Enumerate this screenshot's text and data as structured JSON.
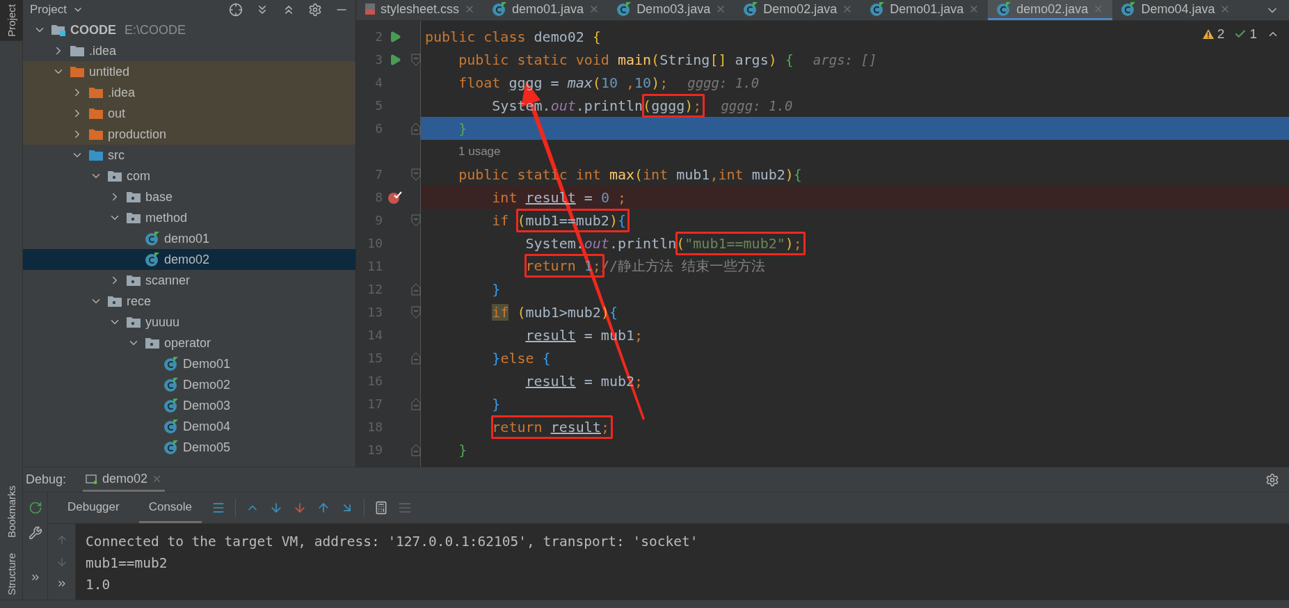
{
  "left_stripe": {
    "top": [
      {
        "label": "Project",
        "selected": true
      }
    ],
    "bottom": [
      {
        "label": "Bookmarks",
        "selected": false
      },
      {
        "label": "Structure",
        "selected": false
      }
    ]
  },
  "project_panel": {
    "title": "Project",
    "tree": [
      {
        "name": "COODE",
        "path": "E:\\COODE",
        "kind": "module",
        "expanded": true,
        "selected": false,
        "highlighted": false,
        "children": [
          {
            "name": ".idea",
            "kind": "folder",
            "expanded": false,
            "selected": false,
            "highlighted": false
          },
          {
            "name": "untitled",
            "kind": "excluded",
            "expanded": true,
            "selected": false,
            "highlighted": true,
            "children": [
              {
                "name": ".idea",
                "kind": "excluded",
                "expanded": false,
                "selected": false,
                "highlighted": true
              },
              {
                "name": "out",
                "kind": "excluded",
                "expanded": false,
                "selected": false,
                "highlighted": true
              },
              {
                "name": "production",
                "kind": "excluded",
                "expanded": false,
                "selected": false,
                "highlighted": true
              },
              {
                "name": "src",
                "kind": "source",
                "expanded": true,
                "selected": false,
                "highlighted": false,
                "children": [
                  {
                    "name": "com",
                    "kind": "package",
                    "expanded": true,
                    "selected": false,
                    "highlighted": false,
                    "children": [
                      {
                        "name": "base",
                        "kind": "package",
                        "expanded": false,
                        "selected": false,
                        "highlighted": false
                      },
                      {
                        "name": "method",
                        "kind": "package",
                        "expanded": true,
                        "selected": false,
                        "highlighted": false,
                        "children": [
                          {
                            "name": "demo01",
                            "kind": "class",
                            "selected": false,
                            "highlighted": false
                          },
                          {
                            "name": "demo02",
                            "kind": "class",
                            "selected": true,
                            "highlighted": false
                          }
                        ]
                      },
                      {
                        "name": "scanner",
                        "kind": "package",
                        "expanded": false,
                        "selected": false,
                        "highlighted": false
                      }
                    ]
                  },
                  {
                    "name": "rece",
                    "kind": "package",
                    "expanded": true,
                    "selected": false,
                    "highlighted": false,
                    "children": [
                      {
                        "name": "yuuuu",
                        "kind": "package",
                        "expanded": true,
                        "selected": false,
                        "highlighted": false,
                        "children": [
                          {
                            "name": "operator",
                            "kind": "package",
                            "expanded": true,
                            "selected": false,
                            "highlighted": false,
                            "children": [
                              {
                                "name": "Demo01",
                                "kind": "class",
                                "selected": false,
                                "highlighted": false
                              },
                              {
                                "name": "Demo02",
                                "kind": "class",
                                "selected": false,
                                "highlighted": false
                              },
                              {
                                "name": "Demo03",
                                "kind": "class",
                                "selected": false,
                                "highlighted": false
                              },
                              {
                                "name": "Demo04",
                                "kind": "class",
                                "selected": false,
                                "highlighted": false
                              },
                              {
                                "name": "Demo05",
                                "kind": "class",
                                "selected": false,
                                "highlighted": false
                              }
                            ]
                          }
                        ]
                      }
                    ]
                  }
                ]
              }
            ]
          }
        ]
      }
    ]
  },
  "editor": {
    "tabs": [
      {
        "label": "stylesheet.css",
        "kind": "css",
        "selected": false
      },
      {
        "label": "demo01.java",
        "kind": "java",
        "selected": false
      },
      {
        "label": "Demo03.java",
        "kind": "java",
        "selected": false
      },
      {
        "label": "Demo02.java",
        "kind": "java",
        "selected": false
      },
      {
        "label": "Demo01.java",
        "kind": "java",
        "selected": false
      },
      {
        "label": "demo02.java",
        "kind": "java",
        "selected": true
      },
      {
        "label": "Demo04.java",
        "kind": "java",
        "selected": false
      }
    ],
    "inspections": {
      "warnings": "2",
      "weak_warnings": "1"
    },
    "lines": [
      {
        "kind": "code",
        "number": "2",
        "run": true,
        "breakpoint": false,
        "current": false,
        "fold_start": false,
        "fold_end": false,
        "tokens": [
          {
            "kind": "keyword",
            "text": "public class "
          },
          {
            "kind": "plain",
            "text": "demo02 "
          },
          {
            "kind": "yellow",
            "text": "{"
          }
        ],
        "children": [
          {
            "kind": "code",
            "number": "3",
            "run": true,
            "breakpoint": false,
            "current": false,
            "fold_start": true,
            "fold_end": false,
            "hint": "args: []",
            "tokens": [
              {
                "kind": "keyword",
                "text": "public static void "
              },
              {
                "kind": "decl",
                "text": "main"
              },
              {
                "kind": "yellow",
                "text": "("
              },
              {
                "kind": "plain",
                "text": "String"
              },
              {
                "kind": "yellow",
                "text": "[]"
              },
              {
                "kind": "plain",
                "text": " args"
              },
              {
                "kind": "yellow",
                "text": ")"
              },
              {
                "kind": "green",
                "text": " {"
              }
            ]
          },
          {
            "kind": "code",
            "number": "4",
            "run": false,
            "breakpoint": false,
            "current": false,
            "fold_start": false,
            "fold_end": false,
            "hint": "gggg: 1.0",
            "tokens": [
              {
                "kind": "keyword",
                "text": "float "
              },
              {
                "kind": "warned",
                "text": "gggg"
              },
              {
                "kind": "plain",
                "text": " = "
              },
              {
                "kind": "call",
                "text": "max"
              },
              {
                "kind": "yellow",
                "text": "("
              },
              {
                "kind": "number",
                "text": "10 "
              },
              {
                "kind": "keyword",
                "text": ","
              },
              {
                "kind": "number",
                "text": "10"
              },
              {
                "kind": "yellow",
                "text": ")"
              },
              {
                "kind": "keyword",
                "text": ";"
              }
            ],
            "children": [
              {
                "kind": "code",
                "number": "5",
                "run": false,
                "breakpoint": false,
                "current": false,
                "fold_start": false,
                "fold_end": false,
                "hint": "gggg: 1.0",
                "tokens": [
                  {
                    "kind": "plain",
                    "text": "System."
                  },
                  {
                    "kind": "field",
                    "text": "out"
                  },
                  {
                    "kind": "plain",
                    "text": ".println"
                  },
                  {
                    "kind": "box",
                    "tokens": [
                      {
                        "kind": "yellow",
                        "text": "("
                      },
                      {
                        "kind": "plain",
                        "text": "gggg"
                      },
                      {
                        "kind": "yellow",
                        "text": ")"
                      },
                      {
                        "kind": "keyword",
                        "text": ";"
                      }
                    ]
                  }
                ]
              }
            ]
          },
          {
            "kind": "code",
            "number": "6",
            "run": false,
            "breakpoint": false,
            "current": true,
            "fold_start": false,
            "fold_end": true,
            "tokens": [
              {
                "kind": "green",
                "text": "}"
              }
            ]
          },
          {
            "kind": "usage",
            "text": "1 usage"
          },
          {
            "kind": "code",
            "number": "7",
            "run": false,
            "breakpoint": false,
            "current": false,
            "fold_start": true,
            "fold_end": false,
            "tokens": [
              {
                "kind": "keyword",
                "text": "public static int "
              },
              {
                "kind": "decl",
                "text": "max"
              },
              {
                "kind": "yellow",
                "text": "("
              },
              {
                "kind": "keyword",
                "text": "int "
              },
              {
                "kind": "plain",
                "text": "mub1"
              },
              {
                "kind": "keyword",
                "text": ",int "
              },
              {
                "kind": "plain",
                "text": "mub2"
              },
              {
                "kind": "yellow",
                "text": ")"
              },
              {
                "kind": "green",
                "text": "{"
              }
            ],
            "children": [
              {
                "kind": "code",
                "number": "8",
                "run": false,
                "breakpoint": true,
                "current": false,
                "fold_start": false,
                "fold_end": false,
                "tokens": [
                  {
                    "kind": "keyword",
                    "text": "int "
                  },
                  {
                    "kind": "reassigned",
                    "text": "result"
                  },
                  {
                    "kind": "plain",
                    "text": " = "
                  },
                  {
                    "kind": "number",
                    "text": "0"
                  },
                  {
                    "kind": "keyword",
                    "text": " ;"
                  }
                ]
              },
              {
                "kind": "code",
                "number": "9",
                "run": false,
                "breakpoint": false,
                "current": false,
                "fold_start": true,
                "fold_end": false,
                "tokens": [
                  {
                    "kind": "keyword",
                    "text": "if "
                  },
                  {
                    "kind": "box",
                    "tokens": [
                      {
                        "kind": "yellow",
                        "text": "("
                      },
                      {
                        "kind": "plain",
                        "text": "mub1==mub2"
                      },
                      {
                        "kind": "yellow",
                        "text": ")"
                      },
                      {
                        "kind": "blue",
                        "text": "{"
                      }
                    ]
                  }
                ],
                "children": [
                  {
                    "kind": "code",
                    "number": "10",
                    "run": false,
                    "breakpoint": false,
                    "current": false,
                    "fold_start": false,
                    "fold_end": false,
                    "tokens": [
                      {
                        "kind": "plain",
                        "text": "System."
                      },
                      {
                        "kind": "field",
                        "text": "out"
                      },
                      {
                        "kind": "plain",
                        "text": ".println"
                      },
                      {
                        "kind": "box",
                        "tokens": [
                          {
                            "kind": "yellow",
                            "text": "("
                          },
                          {
                            "kind": "string",
                            "text": "\"mub1==mub2\""
                          },
                          {
                            "kind": "yellow",
                            "text": ")"
                          },
                          {
                            "kind": "keyword",
                            "text": ";"
                          }
                        ]
                      }
                    ]
                  },
                  {
                    "kind": "code",
                    "number": "11",
                    "run": false,
                    "breakpoint": false,
                    "current": false,
                    "fold_start": false,
                    "fold_end": false,
                    "tokens": [
                      {
                        "kind": "box",
                        "tokens": [
                          {
                            "kind": "keyword",
                            "text": "return "
                          },
                          {
                            "kind": "number",
                            "text": "1"
                          },
                          {
                            "kind": "keyword",
                            "text": ";"
                          }
                        ]
                      },
                      {
                        "kind": "comment",
                        "text": "//静止方法 结束一些方法"
                      }
                    ]
                  }
                ]
              },
              {
                "kind": "code",
                "number": "12",
                "run": false,
                "breakpoint": false,
                "current": false,
                "fold_start": false,
                "fold_end": true,
                "tokens": [
                  {
                    "kind": "blue",
                    "text": "}"
                  }
                ]
              },
              {
                "kind": "code",
                "number": "13",
                "run": false,
                "breakpoint": false,
                "current": false,
                "fold_start": true,
                "fold_end": false,
                "tokens": [
                  {
                    "kind": "marked",
                    "text": "if"
                  },
                  {
                    "kind": "yellow",
                    "text": " ("
                  },
                  {
                    "kind": "plain",
                    "text": "mub1>mub2"
                  },
                  {
                    "kind": "yellow",
                    "text": ")"
                  },
                  {
                    "kind": "blue",
                    "text": "{"
                  }
                ],
                "children": [
                  {
                    "kind": "code",
                    "number": "14",
                    "run": false,
                    "breakpoint": false,
                    "current": false,
                    "fold_start": false,
                    "fold_end": false,
                    "tokens": [
                      {
                        "kind": "reassigned",
                        "text": "result"
                      },
                      {
                        "kind": "plain",
                        "text": " = mub1"
                      },
                      {
                        "kind": "keyword",
                        "text": ";"
                      }
                    ]
                  }
                ]
              },
              {
                "kind": "code",
                "number": "15",
                "run": false,
                "breakpoint": false,
                "current": false,
                "fold_start": false,
                "fold_end": true,
                "tokens": [
                  {
                    "kind": "blue",
                    "text": "}"
                  },
                  {
                    "kind": "keyword",
                    "text": "else "
                  },
                  {
                    "kind": "blue",
                    "text": "{"
                  }
                ],
                "children": [
                  {
                    "kind": "code",
                    "number": "16",
                    "run": false,
                    "breakpoint": false,
                    "current": false,
                    "fold_start": false,
                    "fold_end": false,
                    "tokens": [
                      {
                        "kind": "reassigned",
                        "text": "result"
                      },
                      {
                        "kind": "plain",
                        "text": " = mub2"
                      },
                      {
                        "kind": "keyword",
                        "text": ";"
                      }
                    ]
                  }
                ]
              },
              {
                "kind": "code",
                "number": "17",
                "run": false,
                "breakpoint": false,
                "current": false,
                "fold_start": false,
                "fold_end": true,
                "tokens": [
                  {
                    "kind": "blue",
                    "text": "}"
                  }
                ]
              },
              {
                "kind": "code",
                "number": "18",
                "run": false,
                "breakpoint": false,
                "current": false,
                "fold_start": false,
                "fold_end": false,
                "tokens": [
                  {
                    "kind": "box",
                    "tokens": [
                      {
                        "kind": "keyword",
                        "text": "return "
                      },
                      {
                        "kind": "reassigned",
                        "text": "result"
                      },
                      {
                        "kind": "keyword",
                        "text": ";"
                      }
                    ]
                  }
                ]
              }
            ]
          },
          {
            "kind": "code",
            "number": "19",
            "run": false,
            "breakpoint": false,
            "current": false,
            "fold_start": false,
            "fold_end": true,
            "tokens": [
              {
                "kind": "green",
                "text": "}"
              }
            ]
          }
        ]
      }
    ]
  },
  "debug": {
    "label": "Debug:",
    "session_tab": "demo02",
    "views": [
      {
        "label": "Debugger",
        "selected": false
      },
      {
        "label": "Console",
        "selected": true
      }
    ],
    "console_lines": [
      "Connected to the target VM, address: '127.0.0.1:62105', transport: 'socket'",
      "mub1==mub2",
      "1.0"
    ]
  }
}
